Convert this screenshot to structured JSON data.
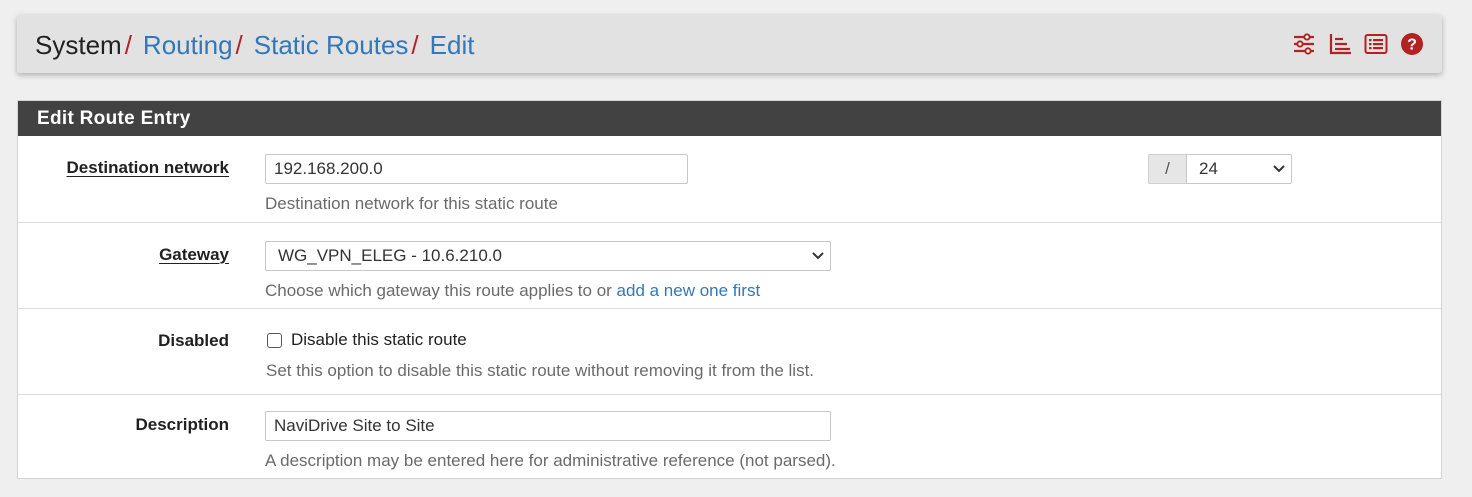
{
  "breadcrumb": {
    "items": [
      {
        "label": "System",
        "link": false
      },
      {
        "label": "Routing",
        "link": true
      },
      {
        "label": "Static Routes",
        "link": true
      },
      {
        "label": "Edit",
        "link": true
      }
    ],
    "separator": "/"
  },
  "header_icons": [
    "sliders-icon",
    "bar-chart-icon",
    "list-icon",
    "help-icon"
  ],
  "colors": {
    "accent_red": "#b22222",
    "link_blue": "#3278b9",
    "panel_heading": "#424242"
  },
  "panel": {
    "title": "Edit Route Entry",
    "destination": {
      "label": "Destination network",
      "value": "192.168.200.0",
      "slash": "/",
      "mask": "24",
      "help": "Destination network for this static route"
    },
    "gateway": {
      "label": "Gateway",
      "value": "WG_VPN_ELEG - 10.6.210.0",
      "help_prefix": "Choose which gateway this route applies to or",
      "help_link": "add a new one first"
    },
    "disabled": {
      "label": "Disabled",
      "checkbox_label": "Disable this static route",
      "checked": false,
      "help": "Set this option to disable this static route without removing it from the list."
    },
    "description": {
      "label": "Description",
      "value": "NaviDrive Site to Site",
      "help": "A description may be entered here for administrative reference (not parsed)."
    }
  }
}
